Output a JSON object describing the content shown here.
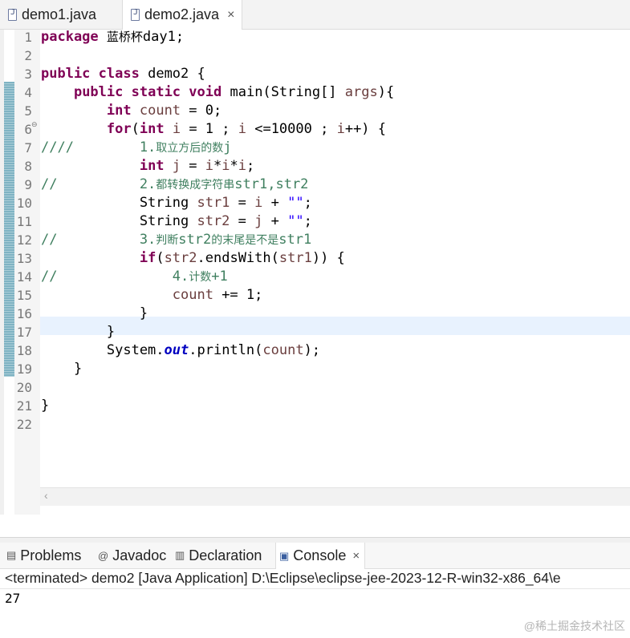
{
  "editor_tabs": [
    {
      "label": "demo1.java",
      "active": false
    },
    {
      "label": "demo2.java",
      "active": true,
      "close": "×"
    }
  ],
  "code": {
    "line_numbers": [
      "1",
      "2",
      "3",
      "4",
      "5",
      "6",
      "7",
      "8",
      "9",
      "10",
      "11",
      "12",
      "13",
      "14",
      "15",
      "16",
      "17",
      "18",
      "19",
      "20",
      "21",
      "22"
    ],
    "current_line": 15,
    "fold_marker": "⊖"
  },
  "views": {
    "tabs": [
      {
        "label": "Problems",
        "icon": "problems-icon",
        "glyph": "▤"
      },
      {
        "label": "Javadoc",
        "icon": "javadoc-icon",
        "glyph": "@"
      },
      {
        "label": "Declaration",
        "icon": "declaration-icon",
        "glyph": "▥"
      },
      {
        "label": "Console",
        "icon": "console-icon",
        "glyph": "▣",
        "active": true,
        "close": "×"
      }
    ],
    "console_header": "<terminated> demo2 [Java Application] D:\\Eclipse\\eclipse-jee-2023-12-R-win32-x86_64\\e",
    "console_output": "27"
  },
  "watermark": "@稀土掘金技术社区",
  "colors": {
    "keyword": "#7f0055",
    "comment": "#3f7f5f",
    "string": "#2a00ff",
    "field": "#0000c0",
    "current_line": "#e8f2fe"
  }
}
